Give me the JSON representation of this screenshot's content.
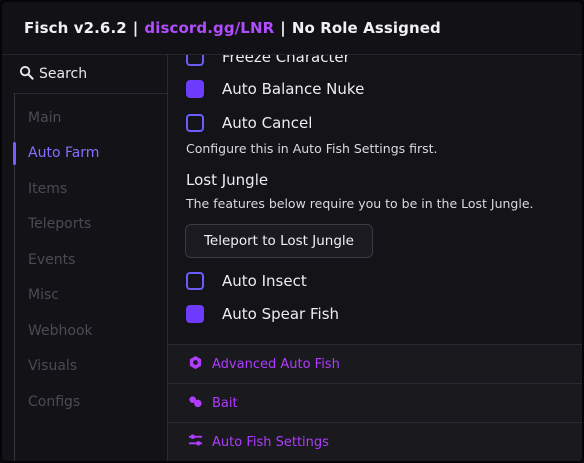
{
  "title": {
    "app": "Fisch v2.6.2",
    "separator1": "|",
    "link": "discord.gg/LNR",
    "separator2": "|",
    "role": "No Role Assigned"
  },
  "search": {
    "label": "Search",
    "icon": "search-icon"
  },
  "sidebar": {
    "items": [
      {
        "label": "Main",
        "active": false
      },
      {
        "label": "Auto Farm",
        "active": true
      },
      {
        "label": "Items",
        "active": false
      },
      {
        "label": "Teleports",
        "active": false
      },
      {
        "label": "Events",
        "active": false
      },
      {
        "label": "Misc",
        "active": false
      },
      {
        "label": "Webhook",
        "active": false
      },
      {
        "label": "Visuals",
        "active": false
      },
      {
        "label": "Configs",
        "active": false
      }
    ]
  },
  "main": {
    "toggles_top": [
      {
        "label": "Freeze Character",
        "checked": false
      },
      {
        "label": "Auto Balance Nuke",
        "checked": true
      },
      {
        "label": "Auto Cancel",
        "checked": false
      }
    ],
    "note1": "Configure this in Auto Fish Settings first.",
    "section_title": "Lost Jungle",
    "note2": "The features below require you to be in the Lost Jungle.",
    "teleport_button": "Teleport to Lost Jungle",
    "toggles_bottom": [
      {
        "label": "Auto Insect",
        "checked": false
      },
      {
        "label": "Auto Spear Fish",
        "checked": true
      }
    ],
    "panels": [
      {
        "label": "Advanced Auto Fish",
        "icon": "hexagon-icon"
      },
      {
        "label": "Bait",
        "icon": "bait-icon"
      },
      {
        "label": "Auto Fish Settings",
        "icon": "sliders-icon"
      }
    ]
  },
  "colors": {
    "accent": "#6e3cff",
    "link": "#b24cff",
    "panel_label": "#b03cff"
  }
}
